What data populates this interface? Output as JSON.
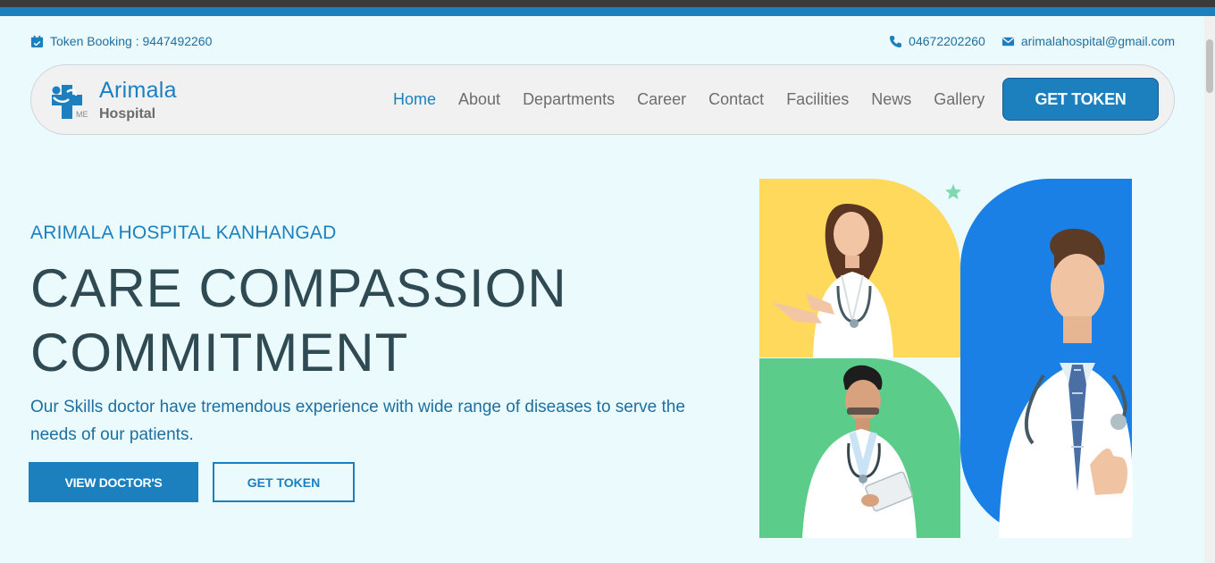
{
  "topbar": {
    "token_booking": "Token Booking : 9447492260",
    "phone": "04672202260",
    "email": "arimalahospital@gmail.com"
  },
  "logo": {
    "title": "Arimala",
    "subtitle": "Hospital"
  },
  "nav": {
    "items": [
      "Home",
      "About",
      "Departments",
      "Career",
      "Contact",
      "Facilities",
      "News",
      "Gallery"
    ],
    "active": "Home",
    "cta": "GET TOKEN"
  },
  "hero": {
    "eyebrow": "ARIMALA HOSPITAL KANHANGAD",
    "headline_line1": "CARE COMPASSION",
    "headline_line2": "COMMITMENT",
    "lead": "Our Skills doctor have tremendous experience with wide range of diseases to serve the needs of our patients.",
    "btn_primary": "VIEW DOCTOR'S",
    "btn_secondary": "GET TOKEN"
  },
  "colors": {
    "accent": "#1c80bf",
    "background": "#eafafd",
    "headline": "#2f4a52",
    "yellow_panel": "#ffd95c",
    "green_panel": "#5ccc8a",
    "blue_panel": "#1a80e6"
  }
}
